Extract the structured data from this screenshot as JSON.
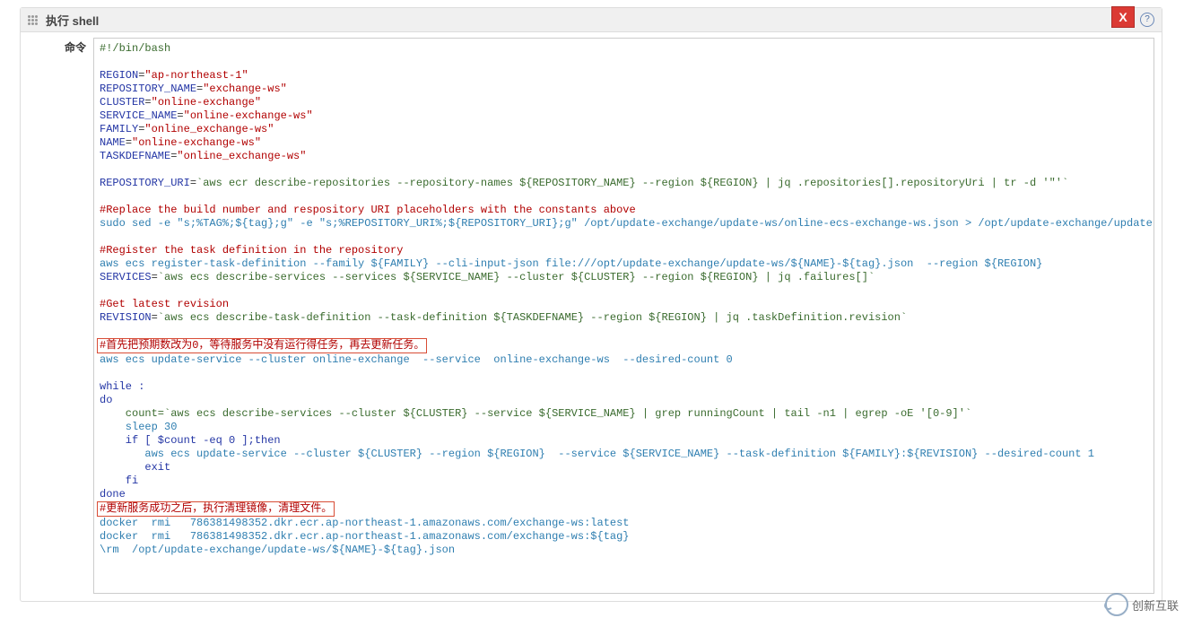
{
  "panel": {
    "title": "执行 shell",
    "close_label": "X",
    "help_label": "?"
  },
  "form": {
    "command_label": "命令"
  },
  "logo": {
    "text": "创新互联"
  },
  "script": {
    "shebang": "#!/bin/bash",
    "assign": {
      "region": {
        "var": "REGION",
        "val": "\"ap-northeast-1\""
      },
      "repo_name": {
        "var": "REPOSITORY_NAME",
        "val": "\"exchange-ws\""
      },
      "cluster": {
        "var": "CLUSTER",
        "val": "\"online-exchange\""
      },
      "service_name": {
        "var": "SERVICE_NAME",
        "val": "\"online-exchange-ws\""
      },
      "family": {
        "var": "FAMILY",
        "val": "\"online_exchange-ws\""
      },
      "name": {
        "var": "NAME",
        "val": "\"online-exchange-ws\""
      },
      "taskdef": {
        "var": "TASKDEFNAME",
        "val": "\"online_exchange-ws\""
      }
    },
    "repo_uri": {
      "var": "REPOSITORY_URI",
      "cmd": "`aws ecr describe-repositories --repository-names ${REPOSITORY_NAME} --region ${REGION} | jq .repositories[].repositoryUri | tr -d '\"'`"
    },
    "comment_replace": "#Replace the build number and respository URI placeholders with the constants above",
    "sed_line": "sudo sed -e \"s;%TAG%;${tag};g\" -e \"s;%REPOSITORY_URI%;${REPOSITORY_URI};g\" /opt/update-exchange/update-ws/online-ecs-exchange-ws.json > /opt/update-exchange/update-ws/${",
    "comment_register": "#Register the task definition in the repository",
    "register_line": "aws ecs register-task-definition --family ${FAMILY} --cli-input-json file:///opt/update-exchange/update-ws/${NAME}-${tag}.json  --region ${REGION}",
    "services_line": {
      "var": "SERVICES",
      "cmd": "`aws ecs describe-services --services ${SERVICE_NAME} --cluster ${CLUSTER} --region ${REGION} | jq .failures[]`"
    },
    "comment_get": "#Get latest revision",
    "revision_line": {
      "var": "REVISION",
      "cmd": "`aws ecs describe-task-definition --task-definition ${TASKDEFNAME} --region ${REGION} | jq .taskDefinition.revision`"
    },
    "comment_cn1": "#首先把预期数改为0，等待服务中没有运行得任务，再去更新任务。",
    "update_zero": "aws ecs update-service --cluster online-exchange  --service  online-exchange-ws  --desired-count 0",
    "while": "while :",
    "do": "do",
    "count_line": "    count=`aws ecs describe-services --cluster ${CLUSTER} --service ${SERVICE_NAME} | grep runningCount | tail -n1 | egrep -oE '[0-9]'`",
    "sleep": "    sleep 30",
    "if": "    if [ $count -eq 0 ];then",
    "update_full": "       aws ecs update-service --cluster ${CLUSTER} --region ${REGION}  --service ${SERVICE_NAME} --task-definition ${FAMILY}:${REVISION} --desired-count 1",
    "exit": "       exit",
    "fi": "    fi",
    "done": "done",
    "comment_cn2": "#更新服务成功之后，执行清理镜像，清理文件。",
    "rmi1": "docker  rmi   786381498352.dkr.ecr.ap-northeast-1.amazonaws.com/exchange-ws:latest",
    "rmi2": "docker  rmi   786381498352.dkr.ecr.ap-northeast-1.amazonaws.com/exchange-ws:${tag}",
    "rm": "\\rm  /opt/update-exchange/update-ws/${NAME}-${tag}.json"
  }
}
